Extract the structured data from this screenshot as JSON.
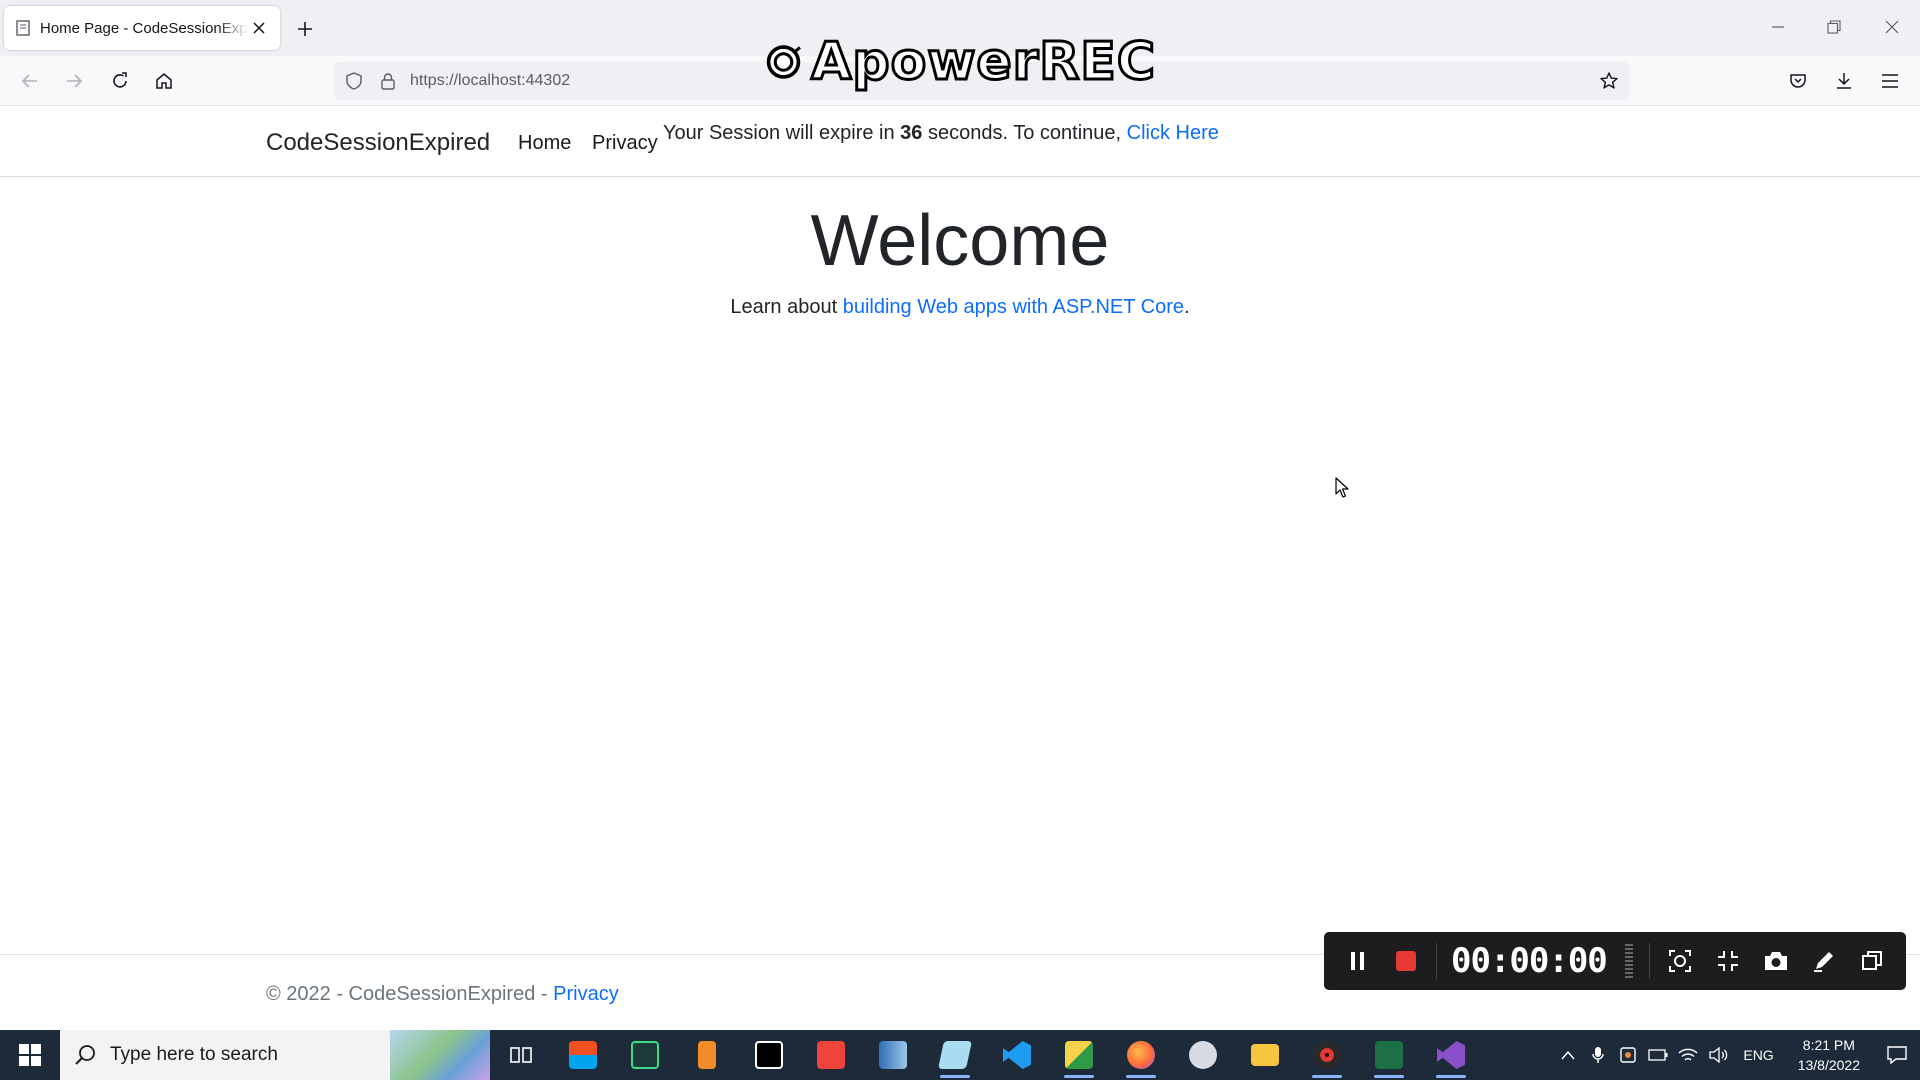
{
  "browser": {
    "tab_title": "Home Page - CodeSessionExpired",
    "url": "https://localhost:44302"
  },
  "watermark": {
    "text": "ApowerREC"
  },
  "site": {
    "brand": "CodeSessionExpired",
    "nav": [
      {
        "label": "Home"
      },
      {
        "label": "Privacy"
      }
    ],
    "session": {
      "prefix": "Your Session will expire in",
      "seconds": "36",
      "middle": "seconds. To continue,",
      "link": "Click Here"
    }
  },
  "main": {
    "heading": "Welcome",
    "lead_prefix": "Learn about",
    "lead_link": "building Web apps with ASP.NET Core",
    "lead_suffix": "."
  },
  "footer": {
    "copyright": "© 2022 - CodeSessionExpired -",
    "privacy": "Privacy"
  },
  "recorder": {
    "timer": "00:00:00"
  },
  "taskbar": {
    "search_placeholder": "Type here to search",
    "language": "ENG",
    "time": "8:21 PM",
    "date": "13/8/2022"
  },
  "colors": {
    "link": "#0d6efd",
    "taskbar": "#1c2a3a",
    "record_red": "#e53935"
  }
}
